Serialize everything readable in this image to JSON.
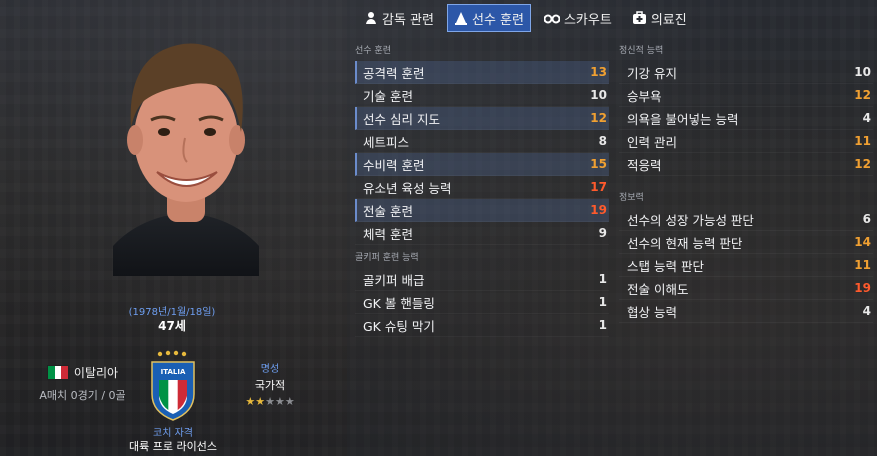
{
  "tabs": [
    {
      "label": "감독 관련",
      "icon": "manager-icon",
      "active": false
    },
    {
      "label": "선수 훈련",
      "icon": "training-cone-icon",
      "active": true
    },
    {
      "label": "스카우트",
      "icon": "binoculars-icon",
      "active": false
    },
    {
      "label": "의료진",
      "icon": "medical-kit-icon",
      "active": false
    }
  ],
  "profile": {
    "dob": "(1978년/1월/18일)",
    "age": "47세",
    "nationality": "이탈리아",
    "caps": "A매치 0경기 / 0골",
    "reputation_label": "명성",
    "reputation_value": "국가적",
    "reputation_stars": 2,
    "reputation_max_stars": 5,
    "coaching_label": "코치 자격",
    "coaching_value": "대륙 프로 라이선스",
    "crest_text": "ITALIA"
  },
  "training": {
    "title": "선수 훈련",
    "items": [
      {
        "name": "공격력 훈련",
        "value": "13"
      },
      {
        "name": "기술 훈련",
        "value": "10"
      },
      {
        "name": "선수 심리 지도",
        "value": "12"
      },
      {
        "name": "세트피스",
        "value": "8"
      },
      {
        "name": "수비력 훈련",
        "value": "15"
      },
      {
        "name": "유소년 육성 능력",
        "value": "17"
      },
      {
        "name": "전술 훈련",
        "value": "19"
      },
      {
        "name": "체력 훈련",
        "value": "9"
      }
    ]
  },
  "goalkeeping": {
    "title": "골키퍼 훈련 능력",
    "items": [
      {
        "name": "골키퍼 배급",
        "value": "1"
      },
      {
        "name": "GK 볼 핸들링",
        "value": "1"
      },
      {
        "name": "GK 슈팅 막기",
        "value": "1"
      }
    ]
  },
  "mental": {
    "title": "정신적 능력",
    "items": [
      {
        "name": "기강 유지",
        "value": "10"
      },
      {
        "name": "승부욕",
        "value": "12"
      },
      {
        "name": "의욕을 불어넣는 능력",
        "value": "4"
      },
      {
        "name": "인력 관리",
        "value": "11"
      },
      {
        "name": "적응력",
        "value": "12"
      }
    ]
  },
  "knowledge": {
    "title": "정보력",
    "items": [
      {
        "name": "선수의 성장 가능성 판단",
        "value": "6"
      },
      {
        "name": "선수의 현재 능력 판단",
        "value": "14"
      },
      {
        "name": "스탭 능력 판단",
        "value": "11"
      },
      {
        "name": "전술 이해도",
        "value": "19"
      },
      {
        "name": "협상 능력",
        "value": "4"
      }
    ]
  },
  "colors": {
    "accent": "#2c57a8",
    "label_blue": "#6e9ef0",
    "value_white": "#e8e8e8",
    "value_orange": "#f0a032",
    "value_red": "#ff5a2c",
    "star_on": "#e7b93c",
    "flag_green": "#009246",
    "flag_white": "#ffffff",
    "flag_red": "#ce2b37"
  }
}
